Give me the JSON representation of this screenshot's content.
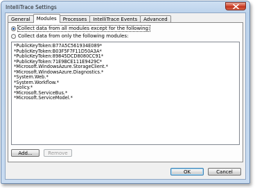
{
  "window": {
    "title": "IntelliTrace Settings"
  },
  "tabs": [
    {
      "label": "General",
      "active": false
    },
    {
      "label": "Modules",
      "active": true
    },
    {
      "label": "Processes",
      "active": false
    },
    {
      "label": "IntelliTrace Events",
      "active": false
    },
    {
      "label": "Advanced",
      "active": false
    }
  ],
  "options": {
    "exclude_label": "Collect data from all modules except for the following:",
    "include_label": "Collect data from only the following modules:",
    "selected": "exclude"
  },
  "modules": [
    "*PublicKeyToken:B77A5C561934E089*",
    "*PublicKeyToken:B03F5F7F11D50A3A*",
    "*PublicKeyToken:89845DCD8080CC91*",
    "*PublicKeyToken:71E9BCE111E9429C*",
    "*Microsoft.WindowsAzure.StorageClient.*",
    "*Microsoft.WindowsAzure.Diagnostics.*",
    "*System.Web.*",
    "*System.Workflow.*",
    "*policy.*",
    "*Microsoft.ServiceBus.*",
    "*Microsoft.ServiceModel.*"
  ],
  "buttons": {
    "add": "Add...",
    "remove": "Remove",
    "ok": "OK",
    "cancel": "Cancel"
  },
  "colors": {
    "accent": "#3c7fb1",
    "close": "#c1321c"
  },
  "icons": {
    "close": "close-icon"
  }
}
